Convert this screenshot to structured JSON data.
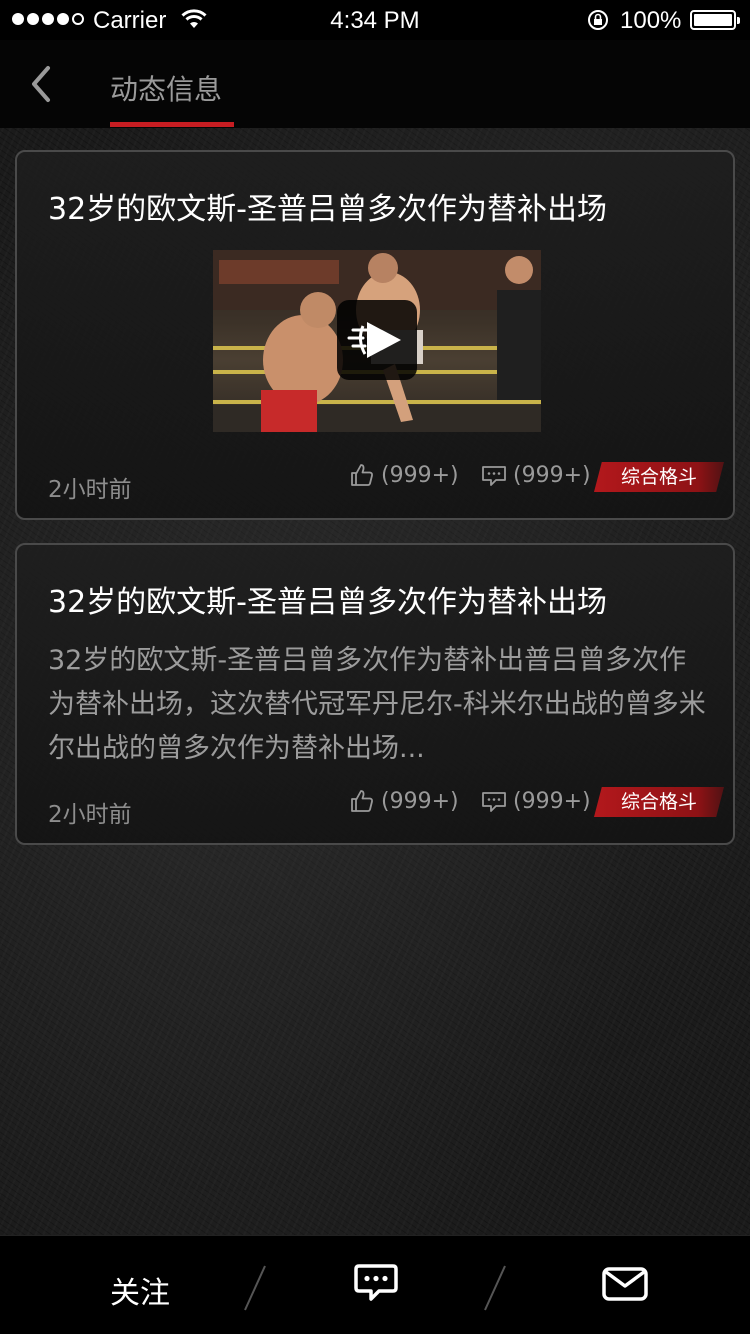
{
  "status_bar": {
    "carrier": "Carrier",
    "time": "4:34 PM",
    "battery": "100%"
  },
  "nav": {
    "back_icon": "chevron-left-icon",
    "tab_label": "动态信息",
    "accent": "#c71d22"
  },
  "feed": [
    {
      "title": "32岁的欧文斯-圣普吕曾多次作为替补出场",
      "has_video": true,
      "time": "2小时前",
      "likes": "(999+)",
      "comments": "(999+)",
      "category": "综合格斗"
    },
    {
      "title": "32岁的欧文斯-圣普吕曾多次作为替补出场",
      "excerpt": "32岁的欧文斯-圣普吕曾多次作为替补出普吕曾多次作为替补出场，这次替代冠军丹尼尔-科米尔出战的曾多米尔出战的曾多次作为替补出场...",
      "time": "2小时前",
      "likes": "(999+)",
      "comments": "(999+)",
      "category": "综合格斗"
    }
  ],
  "tab_bar": {
    "follow_label": "关注",
    "chat_icon": "chat-bubble-icon",
    "mail_icon": "mail-icon"
  }
}
